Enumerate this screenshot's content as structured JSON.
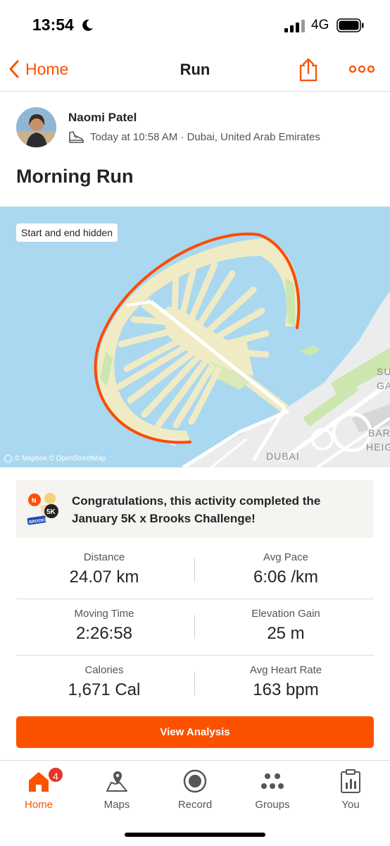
{
  "status_bar": {
    "time": "13:54",
    "network": "4G"
  },
  "nav": {
    "back_label": "Home",
    "title": "Run"
  },
  "athlete": {
    "name": "Naomi Patel",
    "meta": "Today at 10:58 AM · Dubai, United Arab Emirates"
  },
  "activity": {
    "title": "Morning Run"
  },
  "map": {
    "badge": "Start and end hidden",
    "credit": "© Mapbox © OpenStreetMap",
    "labels": [
      "DUBAI",
      "SU",
      "GA",
      "BAR",
      "HEIG"
    ]
  },
  "challenge": {
    "text": "Congratulations, this activity completed the January 5K x Brooks Challenge!"
  },
  "stats": [
    [
      {
        "label": "Distance",
        "value": "24.07 km"
      },
      {
        "label": "Avg Pace",
        "value": "6:06 /km"
      }
    ],
    [
      {
        "label": "Moving Time",
        "value": "2:26:58"
      },
      {
        "label": "Elevation Gain",
        "value": "25 m"
      }
    ],
    [
      {
        "label": "Calories",
        "value": "1,671 Cal"
      },
      {
        "label": "Avg Heart Rate",
        "value": "163 bpm"
      }
    ]
  ],
  "button": {
    "label": "View Analysis"
  },
  "tabs": [
    {
      "label": "Home",
      "icon": "home-icon",
      "badge": "4"
    },
    {
      "label": "Maps",
      "icon": "maps-icon"
    },
    {
      "label": "Record",
      "icon": "record-icon"
    },
    {
      "label": "Groups",
      "icon": "groups-icon"
    },
    {
      "label": "You",
      "icon": "you-icon"
    }
  ],
  "colors": {
    "accent": "#fc5200",
    "text": "#242428",
    "water": "#aad8f0",
    "land": "#f0ebc4",
    "route": "#fc4c02"
  }
}
